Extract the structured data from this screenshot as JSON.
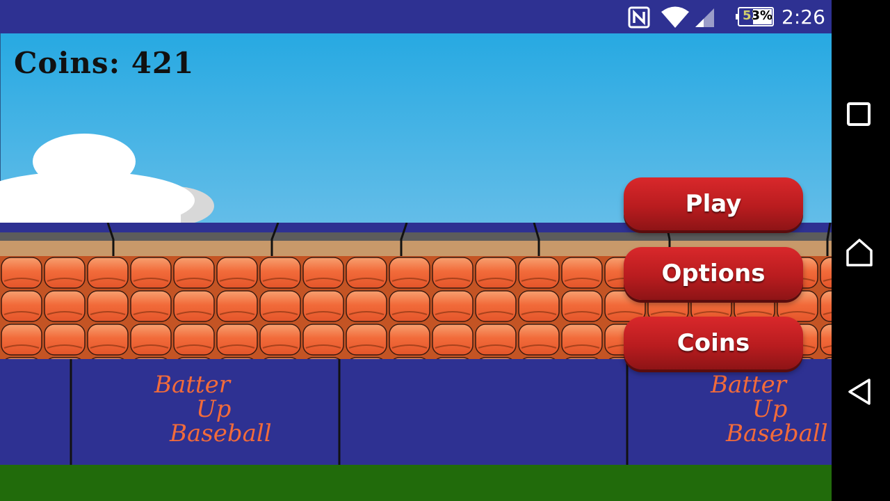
{
  "status_bar": {
    "battery_percent": "53%",
    "time": "2:26",
    "background": "#2e3192",
    "icons": [
      "nfc-icon",
      "wifi-icon",
      "cell-signal-icon",
      "battery-icon"
    ]
  },
  "game": {
    "coins_label": "Coins: 421",
    "menu": {
      "play_label": "Play",
      "options_label": "Options",
      "coins_label": "Coins"
    },
    "banner_text": {
      "line1": "Batter",
      "line2": "Up",
      "line3": "Baseball"
    },
    "colors": {
      "sky_top": "#27a9e2",
      "sky_bottom": "#63bde8",
      "wall": "#2e3192",
      "seats": "#f26b3a",
      "grass": "#216b0b",
      "button": "#c4201f",
      "logo": "#f26b3a"
    }
  },
  "nav_bar": {
    "buttons": [
      "recents-icon",
      "home-icon",
      "back-icon"
    ]
  }
}
